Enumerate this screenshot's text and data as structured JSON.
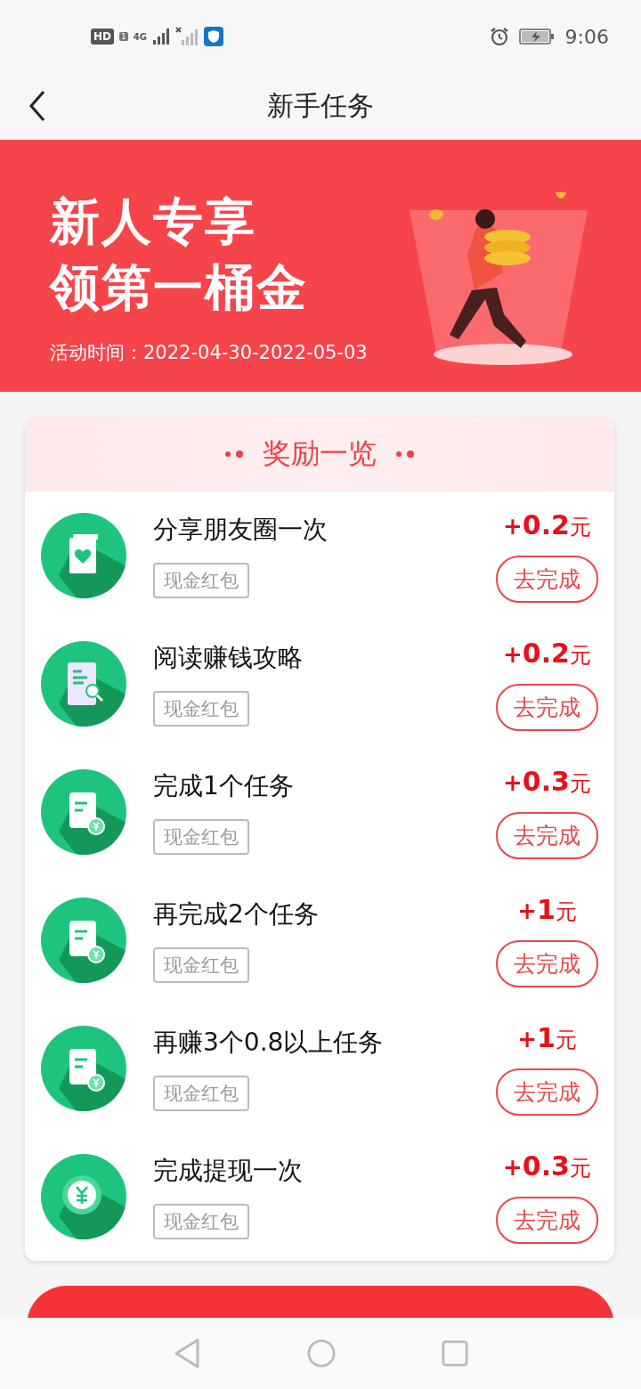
{
  "status_bar": {
    "hd": "HD",
    "sim": "1",
    "network": "4G",
    "time": "9:06"
  },
  "nav": {
    "title": "新手任务"
  },
  "banner": {
    "title_lines": [
      "新人专享",
      "领第一桶金"
    ],
    "period": "活动时间：2022-04-30-2022-05-03"
  },
  "rewards": {
    "title": "奖励一览",
    "tasks": [
      {
        "kind": "share",
        "title": "分享朋友圈一次",
        "tag": "现金红包",
        "sign": "+",
        "amount": "0.2",
        "unit": "元",
        "action": "去完成"
      },
      {
        "kind": "read",
        "title": "阅读赚钱攻略",
        "tag": "现金红包",
        "sign": "+",
        "amount": "0.2",
        "unit": "元",
        "action": "去完成"
      },
      {
        "kind": "task",
        "title": "完成1个任务",
        "tag": "现金红包",
        "sign": "+",
        "amount": "0.3",
        "unit": "元",
        "action": "去完成"
      },
      {
        "kind": "task",
        "title": "再完成2个任务",
        "tag": "现金红包",
        "sign": "+",
        "amount": "1",
        "unit": "元",
        "action": "去完成"
      },
      {
        "kind": "task",
        "title": "再赚3个0.8以上任务",
        "tag": "现金红包",
        "sign": "+",
        "amount": "1",
        "unit": "元",
        "action": "去完成"
      },
      {
        "kind": "withdraw",
        "title": "完成提现一次",
        "tag": "现金红包",
        "sign": "+",
        "amount": "0.3",
        "unit": "元",
        "action": "去完成"
      }
    ]
  }
}
